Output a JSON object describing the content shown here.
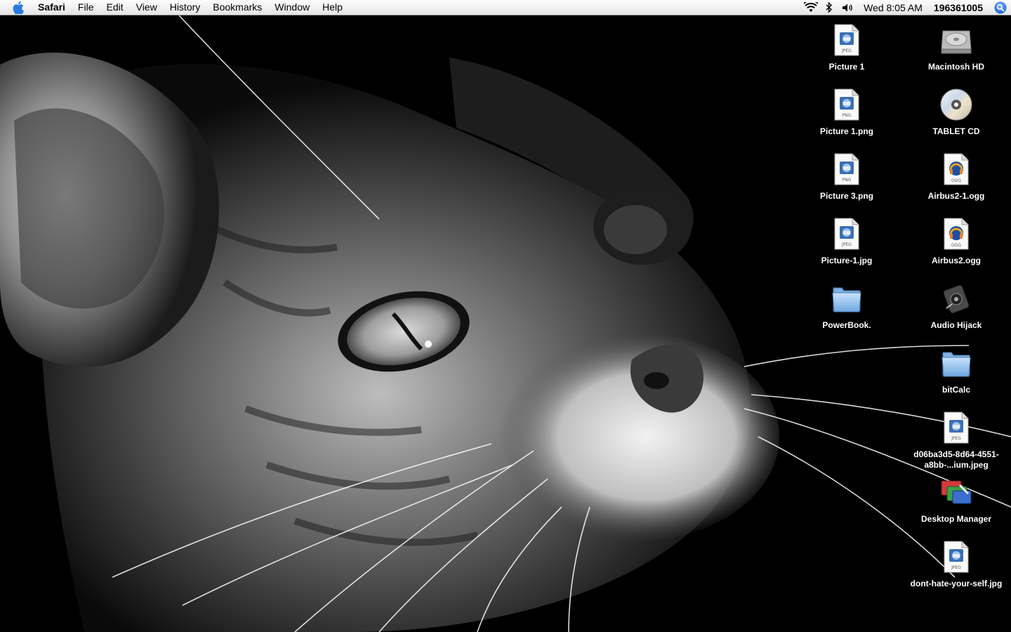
{
  "menubar": {
    "app_name": "Safari",
    "menus": [
      "File",
      "Edit",
      "View",
      "History",
      "Bookmarks",
      "Window",
      "Help"
    ],
    "clock": "Wed 8:05 AM",
    "user": "196361005",
    "status_icons": [
      "wifi-icon",
      "bluetooth-icon",
      "volume-icon"
    ],
    "accent_color": "#1f6fe0"
  },
  "desktop": {
    "icons": [
      {
        "label": "Picture 1",
        "type": "JPEG",
        "kind": "image-file"
      },
      {
        "label": "Macintosh HD",
        "kind": "hard-drive"
      },
      {
        "label": "Picture 1.png",
        "type": "PNG",
        "kind": "image-file"
      },
      {
        "label": "TABLET CD",
        "kind": "cd"
      },
      {
        "label": "Picture 3.png",
        "type": "PNG",
        "kind": "image-file"
      },
      {
        "label": "Airbus2-1.ogg",
        "type": "OGG",
        "kind": "audio-file"
      },
      {
        "label": "Picture-1.jpg",
        "type": "JPEG",
        "kind": "image-file"
      },
      {
        "label": "Airbus2.ogg",
        "type": "OGG",
        "kind": "audio-file"
      },
      {
        "label": "PowerBook.",
        "kind": "folder"
      },
      {
        "label": "Audio Hijack",
        "kind": "app"
      },
      {
        "label": "bitCalc",
        "kind": "folder"
      },
      {
        "label": "d06ba3d5-8d64-4551-a8bb-...ium.jpeg",
        "type": "JPEG",
        "kind": "image-file"
      },
      {
        "label": "Desktop Manager",
        "kind": "app"
      },
      {
        "label": "dont-hate-your-self.jpg",
        "type": "JPEG",
        "kind": "image-file"
      }
    ]
  }
}
